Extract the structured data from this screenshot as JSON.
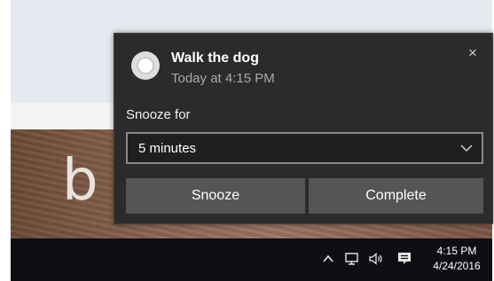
{
  "notification": {
    "title": "Walk the dog",
    "subtitle": "Today at 4:15 PM",
    "close_glyph": "×",
    "snooze_label": "Snooze for",
    "snooze_selected": "5 minutes",
    "snooze_button": "Snooze",
    "complete_button": "Complete"
  },
  "taskbar": {
    "time": "4:15 PM",
    "date": "4/24/2016",
    "icons": [
      "chevron-up-icon",
      "network-icon",
      "volume-icon",
      "action-center-icon"
    ]
  },
  "colors": {
    "toast_background": "#2b2b2b",
    "button_background": "#555555",
    "taskbar_background": "#0d0f12",
    "subtitle_text": "#a9a9a9"
  }
}
